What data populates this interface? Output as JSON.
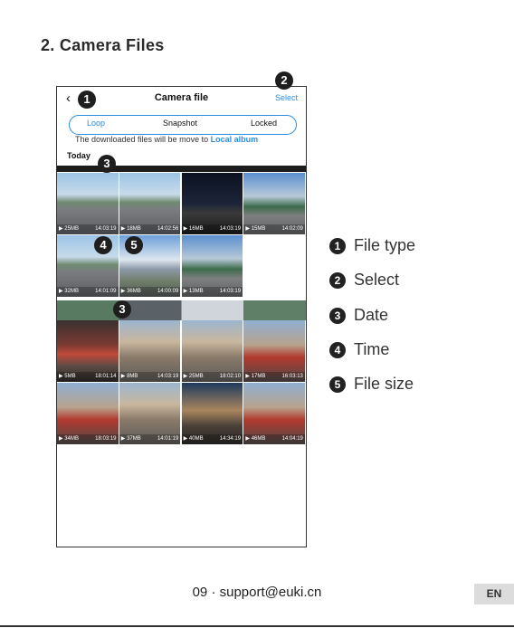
{
  "heading": "2. Camera Files",
  "phone": {
    "back_icon": "back-chevron",
    "title": "Camera file",
    "select_label": "Select",
    "tabs": [
      {
        "label": "Loop",
        "active": true
      },
      {
        "label": "Snapshot",
        "active": false
      },
      {
        "label": "Locked",
        "active": false
      }
    ],
    "notice_text": "The downloaded files will be move to ",
    "notice_link": "Local album",
    "date_label": "Today",
    "group1": [
      {
        "size": "25MB",
        "time": "14:03:19"
      },
      {
        "size": "18MB",
        "time": "14:02:56"
      },
      {
        "size": "16MB",
        "time": "14:03:19"
      },
      {
        "size": "15MB",
        "time": "14:02:09"
      },
      {
        "size": "32MB",
        "time": "14:01:09"
      },
      {
        "size": "36MB",
        "time": "14:00:09"
      },
      {
        "size": "13MB",
        "time": "14:03:19"
      }
    ],
    "group2": [
      {
        "size": "5MB",
        "time": "18:01:14"
      },
      {
        "size": "8MB",
        "time": "14:03:19"
      },
      {
        "size": "25MB",
        "time": "18:02:10"
      },
      {
        "size": "17MB",
        "time": "16:03:13"
      },
      {
        "size": "34MB",
        "time": "18:03:19"
      },
      {
        "size": "37MB",
        "time": "14:01:19"
      },
      {
        "size": "40MB",
        "time": "14:34:19"
      },
      {
        "size": "46MB",
        "time": "14:04:19"
      }
    ]
  },
  "callouts": [
    "1",
    "2",
    "3",
    "4",
    "5",
    "3"
  ],
  "legend": [
    {
      "num": "1",
      "label": "File type"
    },
    {
      "num": "2",
      "label": "Select"
    },
    {
      "num": "3",
      "label": "Date"
    },
    {
      "num": "4",
      "label": "Time"
    },
    {
      "num": "5",
      "label": "File size"
    }
  ],
  "footer": "09 · support@euki.cn",
  "lang_badge": "EN",
  "colors": {
    "accent": "#2b8de0",
    "callout": "#1e1e1e"
  }
}
